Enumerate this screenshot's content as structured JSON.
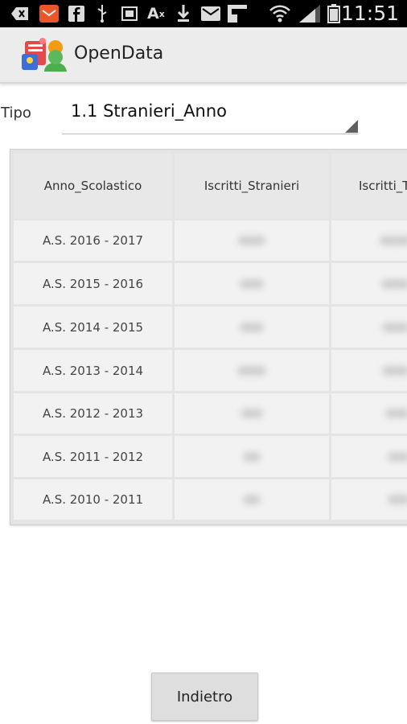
{
  "status_bar": {
    "time": "11:51",
    "icons": [
      "back-icon",
      "mail-icon",
      "facebook-icon",
      "usb-icon",
      "sim-icon",
      "font-icon",
      "download-icon",
      "gmail-icon",
      "pinterest-icon",
      "wifi-icon",
      "signal-icon",
      "battery-icon"
    ]
  },
  "action_bar": {
    "title": "OpenData"
  },
  "form": {
    "tipo_label": "Tipo",
    "tipo_value": "1.1 Stranieri_Anno"
  },
  "table": {
    "headers": [
      "Anno_Scolastico",
      "Iscritti_Stranieri",
      "Iscritti_T"
    ],
    "rows": [
      "A.S. 2016 - 2017",
      "A.S. 2015 - 2016",
      "A.S. 2014 - 2015",
      "A.S. 2013 - 2014",
      "A.S. 2012 - 2013",
      "A.S. 2011 - 2012",
      "A.S. 2010 - 2011"
    ]
  },
  "buttons": {
    "back_label": "Indietro"
  },
  "colors": {
    "status_bar": "#000000",
    "action_bar": "#ececec",
    "table_bg": "#e4e4e4"
  }
}
